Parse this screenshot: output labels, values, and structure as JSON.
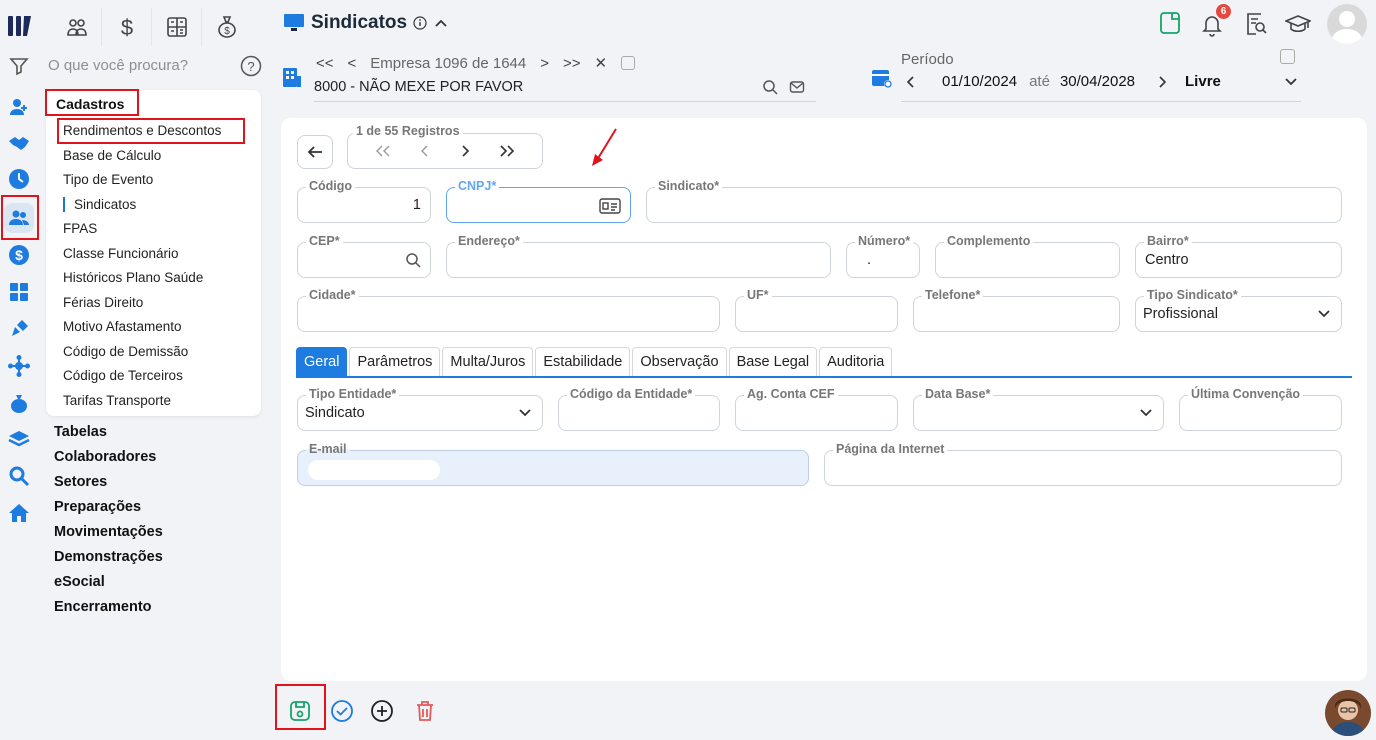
{
  "header": {
    "title": "Sindicatos"
  },
  "search": {
    "placeholder": "O que você procura?"
  },
  "sidebar": {
    "section_title": "Cadastros",
    "items": [
      "Rendimentos e Descontos",
      "Base de Cálculo",
      "Tipo de Evento",
      "Sindicatos",
      "FPAS",
      "Classe Funcionário",
      "Históricos Plano Saúde",
      "Férias Direito",
      "Motivo Afastamento",
      "Código de Demissão",
      "Código de Terceiros",
      "Tarifas Transporte"
    ],
    "groups": [
      "Tabelas",
      "Colaboradores",
      "Setores",
      "Preparações",
      "Movimentações",
      "Demonstrações",
      "eSocial",
      "Encerramento"
    ]
  },
  "company": {
    "nav_first": "<<",
    "nav_prev": "<",
    "nav_text": "Empresa 1096 de 1644",
    "nav_next": ">",
    "nav_last": ">>",
    "nav_close": "✕",
    "name": "8000 - NÃO MEXE POR FAVOR"
  },
  "period": {
    "label": "Período",
    "start": "01/10/2024",
    "sep": "até",
    "end": "30/04/2028",
    "mode": "Livre"
  },
  "notifications": {
    "count": "6"
  },
  "records": {
    "label": "1 de 55 Registros"
  },
  "form": {
    "codigo": {
      "label": "Código",
      "value": "1"
    },
    "cnpj": {
      "label": "CNPJ*",
      "value": ""
    },
    "sindicato": {
      "label": "Sindicato*",
      "value": ""
    },
    "cep": {
      "label": "CEP*",
      "value": ""
    },
    "endereco": {
      "label": "Endereço*",
      "value": ""
    },
    "numero": {
      "label": "Número*",
      "value": "."
    },
    "complemento": {
      "label": "Complemento",
      "value": ""
    },
    "bairro": {
      "label": "Bairro*",
      "value": "Centro"
    },
    "cidade": {
      "label": "Cidade*",
      "value": ""
    },
    "uf": {
      "label": "UF*",
      "value": ""
    },
    "telefone": {
      "label": "Telefone*",
      "value": ""
    },
    "tipo_sindicato": {
      "label": "Tipo Sindicato*",
      "value": "Profissional"
    }
  },
  "tabs": [
    "Geral",
    "Parâmetros",
    "Multa/Juros",
    "Estabilidade",
    "Observação",
    "Base Legal",
    "Auditoria"
  ],
  "geral": {
    "tipo_entidade": {
      "label": "Tipo Entidade*",
      "value": "Sindicato"
    },
    "codigo_entidade": {
      "label": "Código da Entidade*",
      "value": ""
    },
    "ag_conta_cef": {
      "label": "Ag. Conta CEF",
      "value": ""
    },
    "data_base": {
      "label": "Data Base*",
      "value": ""
    },
    "ultima_convencao": {
      "label": "Última Convenção",
      "value": ""
    },
    "email": {
      "label": "E-mail",
      "value": ""
    },
    "pagina_internet": {
      "label": "Página da Internet",
      "value": ""
    }
  },
  "colors": {
    "accent": "#1e7be0",
    "highlight": "#e0141b",
    "save": "#16a36b",
    "delete": "#e55a5a"
  }
}
